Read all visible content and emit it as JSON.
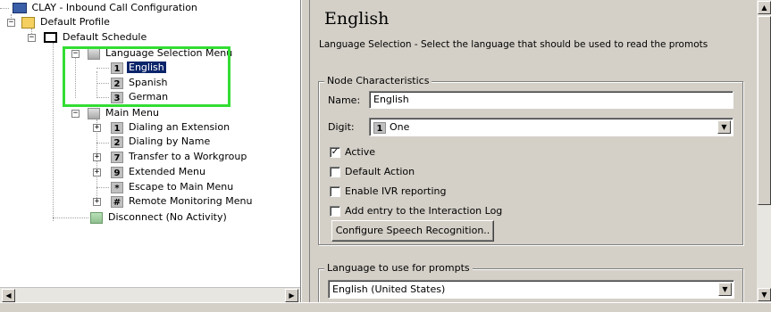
{
  "tree": {
    "root": {
      "label": "CLAY - Inbound Call Configuration",
      "icon": "computer-icon"
    },
    "profile": {
      "label": "Default Profile",
      "icon": "profile-icon"
    },
    "schedule": {
      "label": "Default Schedule",
      "icon": "calendar-icon"
    },
    "language_menu": {
      "label": "Language Selection Menu",
      "icon": "menu-node-icon"
    },
    "language_items": [
      {
        "digit": "1",
        "label": "English",
        "selected": true
      },
      {
        "digit": "2",
        "label": "Spanish"
      },
      {
        "digit": "3",
        "label": "German"
      }
    ],
    "main_menu": {
      "label": "Main Menu",
      "icon": "menu-node-icon"
    },
    "main_menu_items": [
      {
        "digit": "1",
        "label": "Dialing an Extension",
        "expandable": true
      },
      {
        "digit": "2",
        "label": "Dialing by Name",
        "expandable": false
      },
      {
        "digit": "7",
        "label": "Transfer to a Workgroup",
        "expandable": true
      },
      {
        "digit": "9",
        "label": "Extended Menu",
        "expandable": true
      },
      {
        "digit": "*",
        "label": "Escape to Main Menu",
        "expandable": false
      },
      {
        "digit": "#",
        "label": "Remote Monitoring Menu",
        "expandable": true
      }
    ],
    "disconnect": {
      "label": "Disconnect (No Activity)",
      "icon": "disconnect-icon"
    }
  },
  "detail": {
    "title": "English",
    "description": "Language Selection - Select the language that should be used to read the promots",
    "node_characteristics": {
      "legend": "Node Characteristics",
      "name_label": "Name:",
      "name_value": "English",
      "digit_label": "Digit:",
      "digit_badge": "1",
      "digit_value": "One",
      "checkboxes": [
        {
          "label": "Active",
          "checked": true
        },
        {
          "label": "Default Action",
          "checked": false
        },
        {
          "label": "Enable IVR reporting",
          "checked": false
        },
        {
          "label": "Add entry to the Interaction Log",
          "checked": false
        }
      ],
      "speech_button": "Configure Speech Recognition.."
    },
    "prompt_language": {
      "legend": "Language to use for prompts",
      "value": "English (United States)"
    }
  },
  "colors": {
    "highlight": "#33dd33",
    "selection": "#0a246a"
  }
}
